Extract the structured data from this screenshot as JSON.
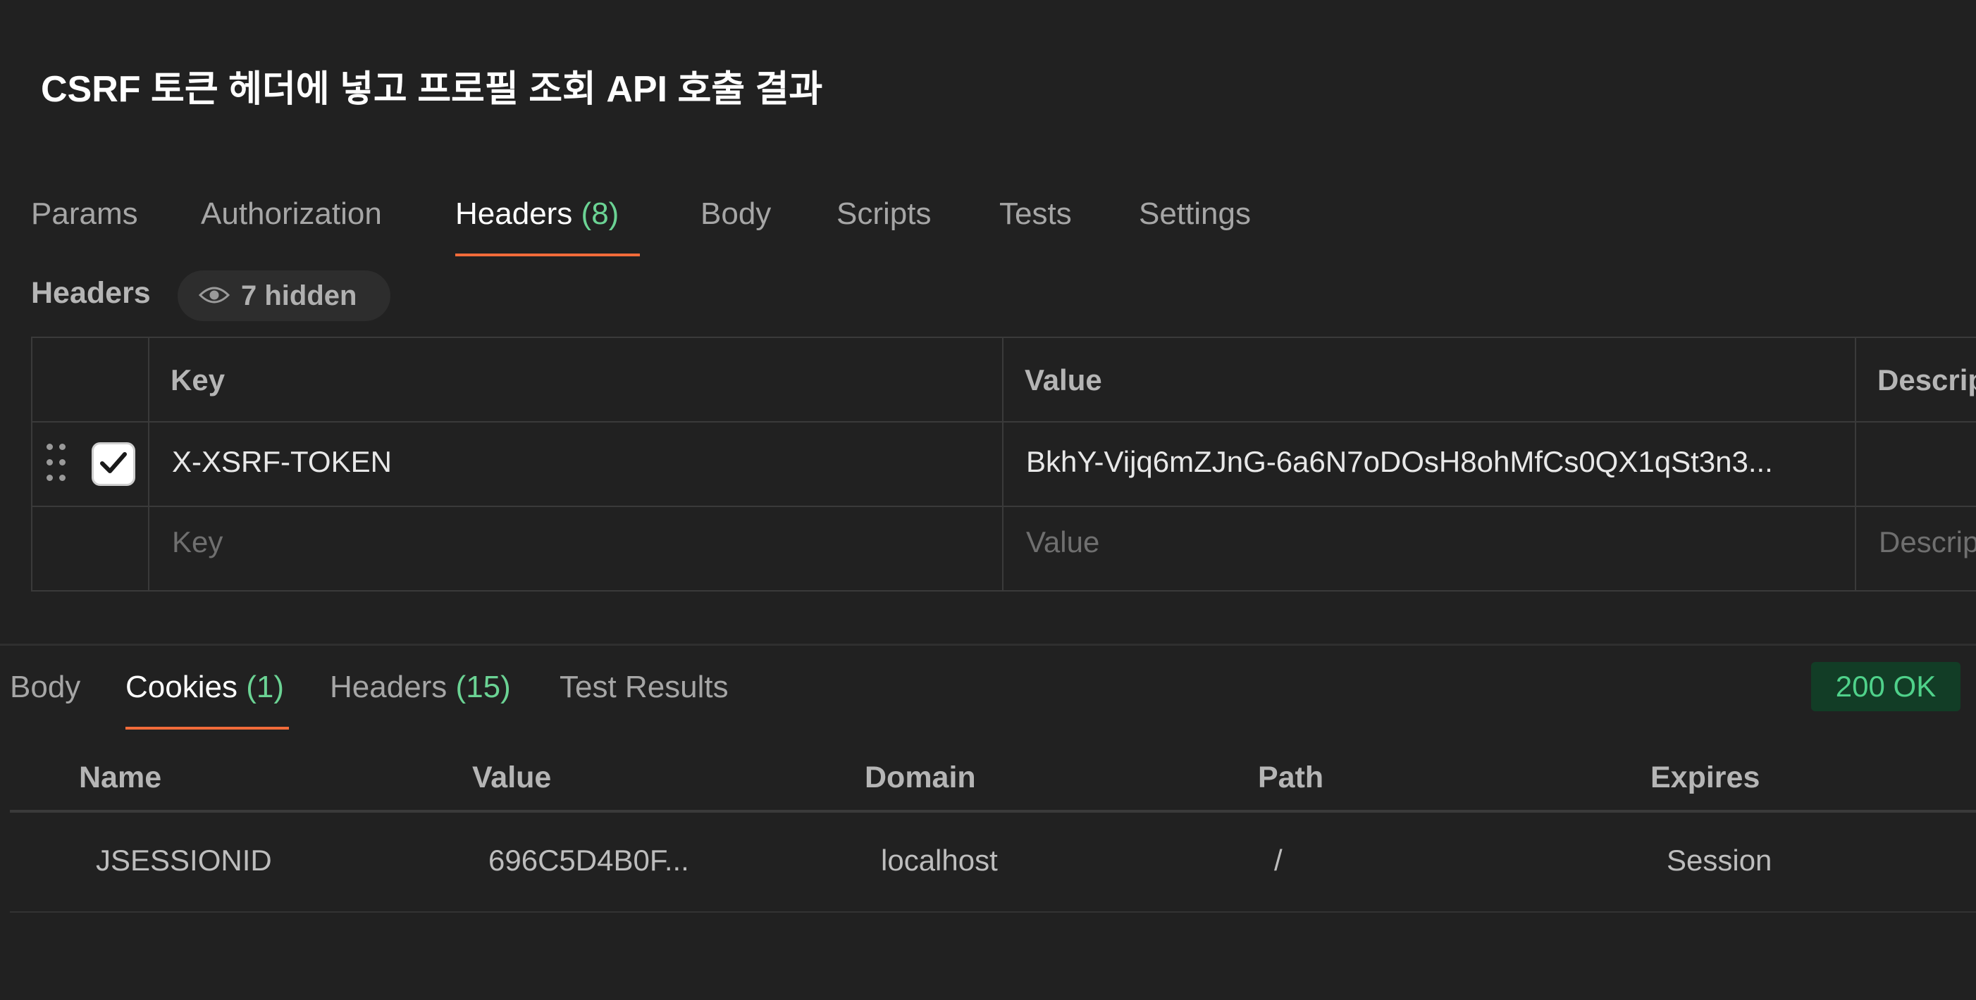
{
  "title": "CSRF 토큰 헤더에 넣고 프로필 조회 API 호출 결과",
  "request_tabs": [
    {
      "label": "Params",
      "count": ""
    },
    {
      "label": "Authorization",
      "count": ""
    },
    {
      "label": "Headers",
      "count": "(8)"
    },
    {
      "label": "Body",
      "count": ""
    },
    {
      "label": "Scripts",
      "count": ""
    },
    {
      "label": "Tests",
      "count": ""
    },
    {
      "label": "Settings",
      "count": ""
    }
  ],
  "headers_section": {
    "label": "Headers",
    "hidden_label": "7 hidden",
    "columns": {
      "key": "Key",
      "value": "Value",
      "description": "Descrip"
    },
    "rows": [
      {
        "key": "X-XSRF-TOKEN",
        "value": "BkhY-Vijq6mZJnG-6a6N7oDOsH8ohMfCs0QX1qSt3n3...",
        "checked": true
      }
    ],
    "placeholders": {
      "key": "Key",
      "value": "Value",
      "description": "Descrip"
    }
  },
  "response_tabs": [
    {
      "label": "Body",
      "count": ""
    },
    {
      "label": "Cookies",
      "count": "(1)"
    },
    {
      "label": "Headers",
      "count": "(15)"
    },
    {
      "label": "Test Results",
      "count": ""
    }
  ],
  "status": "200 OK",
  "cookies": {
    "columns": {
      "name": "Name",
      "value": "Value",
      "domain": "Domain",
      "path": "Path",
      "expires": "Expires"
    },
    "rows": [
      {
        "name": "JSESSIONID",
        "value": "696C5D4B0F...",
        "domain": "localhost",
        "path": "/",
        "expires": "Session"
      }
    ]
  },
  "colors": {
    "accent": "#f26b3a",
    "count": "#6bd394",
    "status_bg": "#123d26",
    "status_text": "#4fd18a"
  }
}
